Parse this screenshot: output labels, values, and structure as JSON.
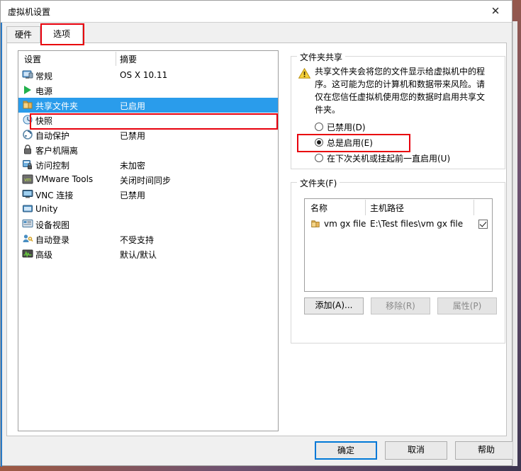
{
  "window": {
    "title": "虚拟机设置",
    "close_label": "✕"
  },
  "tabs": [
    {
      "label": "硬件",
      "active": false
    },
    {
      "label": "选项",
      "active": true
    }
  ],
  "settings_list": {
    "headers": {
      "name": "设置",
      "summary": "摘要"
    },
    "rows": [
      {
        "icon": "monitor-icon",
        "name": "常规",
        "summary": "OS X 10.11",
        "selected": false
      },
      {
        "icon": "power-icon",
        "name": "电源",
        "summary": "",
        "selected": false
      },
      {
        "icon": "folder-icon",
        "name": "共享文件夹",
        "summary": "已启用",
        "selected": true
      },
      {
        "icon": "snapshot-icon",
        "name": "快照",
        "summary": "",
        "selected": false
      },
      {
        "icon": "autoprotect-icon",
        "name": "自动保护",
        "summary": "已禁用",
        "selected": false
      },
      {
        "icon": "lock-icon",
        "name": "客户机隔离",
        "summary": "",
        "selected": false
      },
      {
        "icon": "access-control-icon",
        "name": "访问控制",
        "summary": "未加密",
        "selected": false
      },
      {
        "icon": "vmware-tools-icon",
        "name": "VMware Tools",
        "summary": "关闭时间同步",
        "selected": false
      },
      {
        "icon": "vnc-icon",
        "name": "VNC 连接",
        "summary": "已禁用",
        "selected": false
      },
      {
        "icon": "unity-icon",
        "name": "Unity",
        "summary": "",
        "selected": false
      },
      {
        "icon": "device-view-icon",
        "name": "设备视图",
        "summary": "",
        "selected": false
      },
      {
        "icon": "autologin-icon",
        "name": "自动登录",
        "summary": "不受支持",
        "selected": false
      },
      {
        "icon": "advanced-icon",
        "name": "高级",
        "summary": "默认/默认",
        "selected": false
      }
    ]
  },
  "sharing": {
    "group_title": "文件夹共享",
    "warning_icon": "warning-icon",
    "warning_text": "共享文件夹会将您的文件显示给虚拟机中的程序。这可能为您的计算机和数据带来风险。请仅在您信任虚拟机使用您的数据时启用共享文件夹。",
    "options": [
      {
        "label": "已禁用(D)",
        "accel": "D",
        "selected": false
      },
      {
        "label": "总是启用(E)",
        "accel": "E",
        "selected": true
      },
      {
        "label": "在下次关机或挂起前一直启用(U)",
        "accel": "U",
        "selected": false
      }
    ]
  },
  "folders": {
    "group_title": "文件夹(F)",
    "headers": {
      "name": "名称",
      "path": "主机路径"
    },
    "rows": [
      {
        "icon": "folder-icon",
        "name": "vm gx file",
        "path": "E:\\Test files\\vm gx file",
        "enabled": true
      }
    ],
    "buttons": [
      {
        "label": "添加(A)...",
        "disabled": false
      },
      {
        "label": "移除(R)",
        "disabled": true
      },
      {
        "label": "属性(P)",
        "disabled": true
      }
    ]
  },
  "footer": {
    "ok": "确定",
    "cancel": "取消",
    "help": "帮助"
  },
  "highlights": {
    "accent": "#e8000d",
    "selection": "#2a9ceb",
    "default_button": "#0078d7"
  }
}
